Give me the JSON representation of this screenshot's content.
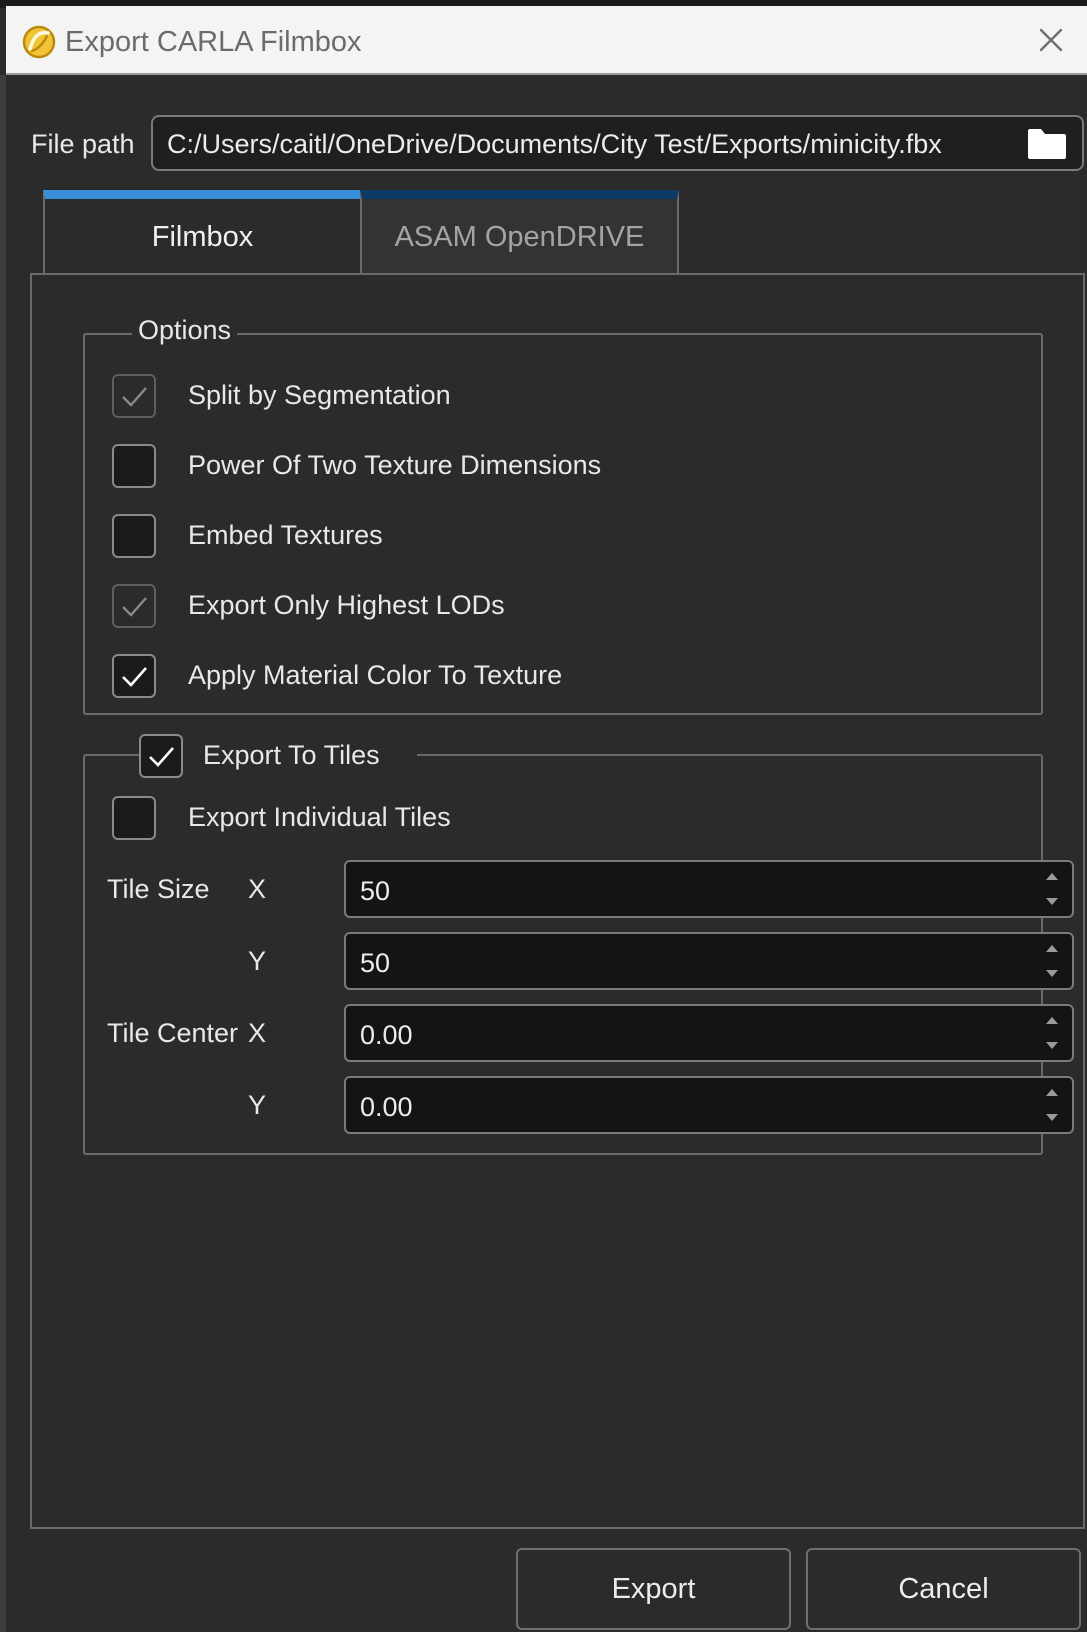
{
  "window": {
    "title": "Export CARLA Filmbox"
  },
  "file_path": {
    "label": "File path",
    "value": "C:/Users/caitl/OneDrive/Documents/City Test/Exports/minicity.fbx"
  },
  "tabs": [
    {
      "label": "Filmbox",
      "active": true
    },
    {
      "label": "ASAM OpenDRIVE",
      "active": false
    }
  ],
  "options": {
    "legend": "Options",
    "items": [
      {
        "label": "Split by Segmentation",
        "checked": true,
        "enabled": false
      },
      {
        "label": "Power Of Two Texture Dimensions",
        "checked": false,
        "enabled": true
      },
      {
        "label": "Embed Textures",
        "checked": false,
        "enabled": true
      },
      {
        "label": "Export Only Highest LODs",
        "checked": true,
        "enabled": false
      },
      {
        "label": "Apply Material Color To Texture",
        "checked": true,
        "enabled": true
      }
    ]
  },
  "tiles": {
    "legend": "Export To Tiles",
    "legend_checked": true,
    "individual": {
      "label": "Export Individual Tiles",
      "checked": false
    },
    "tile_size": {
      "label": "Tile Size",
      "x_label": "X",
      "x": "50",
      "y_label": "Y",
      "y": "50"
    },
    "tile_center": {
      "label": "Tile Center",
      "x_label": "X",
      "x": "0.00",
      "y_label": "Y",
      "y": "0.00"
    }
  },
  "buttons": {
    "export": "Export",
    "cancel": "Cancel"
  },
  "colors": {
    "accent_active_tab": "#3a8fd9",
    "accent_inactive_tab": "#0d3a66",
    "background": "#2b2b2b"
  }
}
